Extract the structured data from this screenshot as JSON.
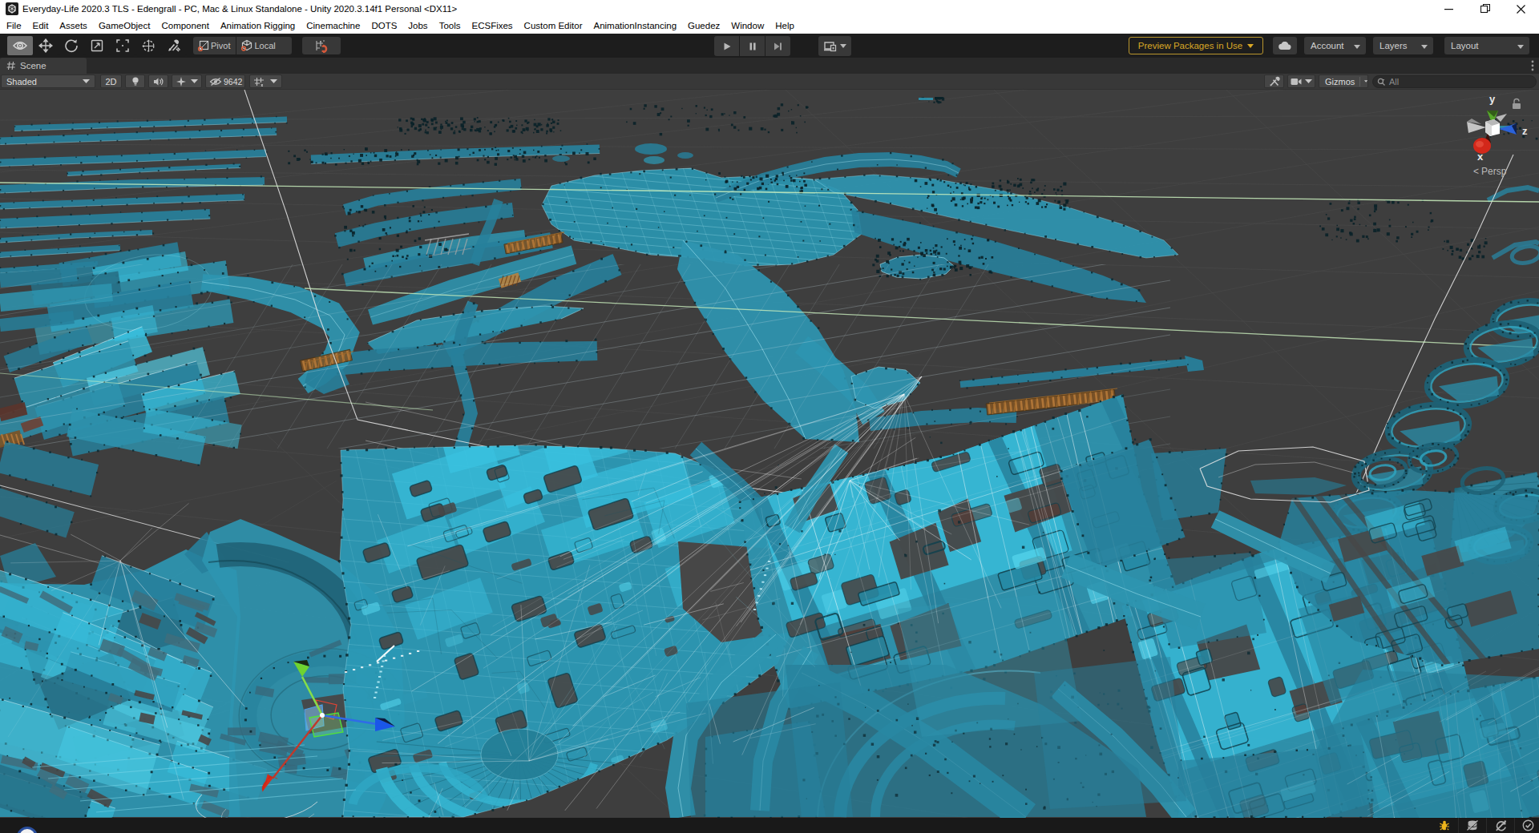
{
  "window": {
    "title": "Everyday-Life 2020.3 TLS - Edengrall - PC, Mac & Linux Standalone - Unity 2020.3.14f1 Personal <DX11>",
    "controls": {
      "minimize": "minimize",
      "maximize": "maximize",
      "close": "close"
    }
  },
  "menubar": {
    "items": [
      "File",
      "Edit",
      "Assets",
      "GameObject",
      "Component",
      "Animation Rigging",
      "Cinemachine",
      "DOTS",
      "Jobs",
      "Tools",
      "ECSFixes",
      "Custom Editor",
      "AnimationInstancing",
      "Guedez",
      "Window",
      "Help"
    ]
  },
  "toolbar": {
    "tools": [
      "view-tool",
      "move-tool",
      "rotate-tool",
      "scale-tool",
      "rect-tool",
      "transform-tool",
      "custom-tools"
    ],
    "pivot_label": "Pivot",
    "local_label": "Local",
    "preview_packages_label": "Preview Packages in Use",
    "account_label": "Account",
    "layers_label": "Layers",
    "layout_label": "Layout"
  },
  "scene_panel": {
    "tab_label": "Scene",
    "draw_mode": "Shaded",
    "toggle_2d": "2D",
    "hidden_objects_count": "9642",
    "gizmos_label": "Gizmos",
    "search_placeholder": "All"
  },
  "viewport": {
    "axis_gizmo": {
      "x_label": "x",
      "y_label": "y",
      "z_label": "z",
      "projection_label": "Persp",
      "projection_prefix": "<"
    },
    "colors": {
      "background": "#3e3e3e",
      "navmesh_cyan": "#2e95b0",
      "navmesh_bright": "#39c2e0",
      "grid_major_green": "#c9eebd",
      "selection_wire": "#ffffff",
      "axis_x_red": "#d3281a",
      "axis_y_green": "#57a82a",
      "axis_z_blue": "#2b62d9",
      "offmesh_link_orange": "#c08038"
    }
  },
  "statusbar": {
    "icons": [
      "debug-bug",
      "cache-server-off",
      "auto-refresh-off",
      "progress-check"
    ]
  }
}
